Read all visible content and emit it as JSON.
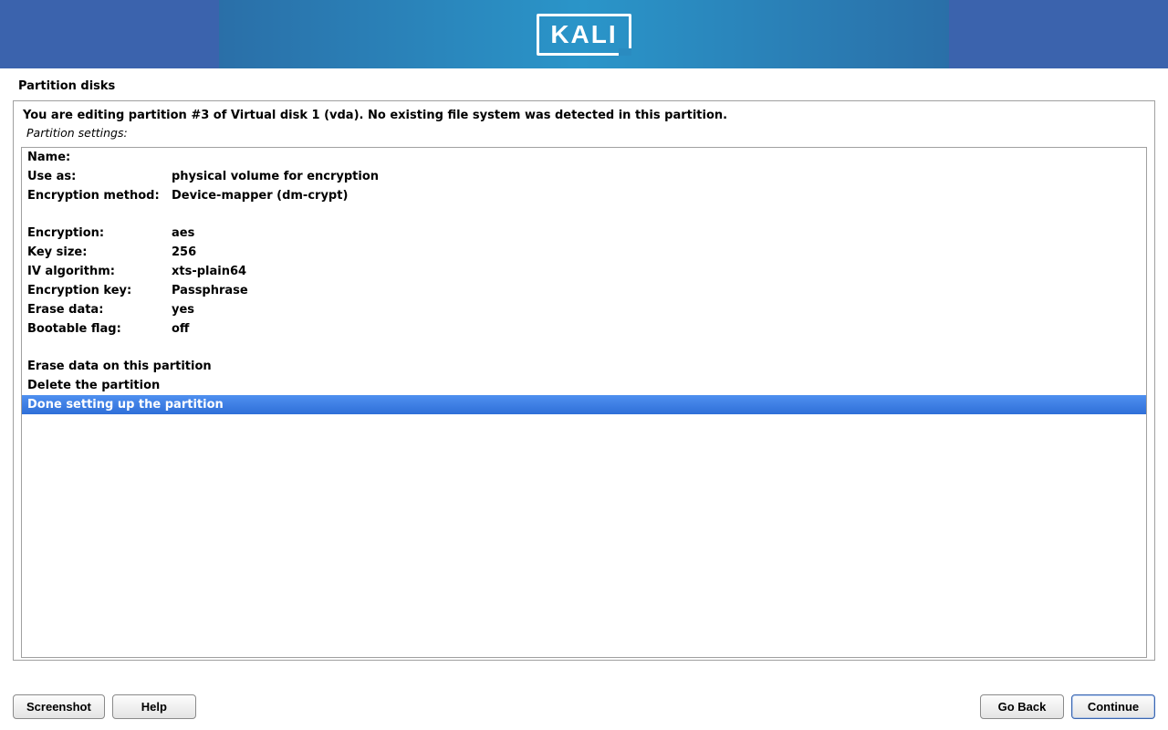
{
  "header": {
    "brand": "KALI"
  },
  "page_title": "Partition disks",
  "description": "You are editing partition #3 of Virtual disk 1 (vda). No existing file system was detected in this partition.",
  "sub_description": "Partition settings:",
  "settings_group1": [
    {
      "key": "Name:",
      "value": ""
    },
    {
      "key": "Use as:",
      "value": "physical volume for encryption"
    },
    {
      "key": "Encryption method:",
      "value": "Device-mapper (dm-crypt)"
    }
  ],
  "settings_group2": [
    {
      "key": "Encryption:",
      "value": "aes"
    },
    {
      "key": "Key size:",
      "value": "256"
    },
    {
      "key": "IV algorithm:",
      "value": "xts-plain64"
    },
    {
      "key": "Encryption key:",
      "value": "Passphrase"
    },
    {
      "key": "Erase data:",
      "value": "yes"
    },
    {
      "key": "Bootable flag:",
      "value": "off"
    }
  ],
  "actions": [
    {
      "label": "Erase data on this partition",
      "selected": false
    },
    {
      "label": "Delete the partition",
      "selected": false
    },
    {
      "label": "Done setting up the partition",
      "selected": true
    }
  ],
  "buttons": {
    "screenshot": "Screenshot",
    "help": "Help",
    "go_back": "Go Back",
    "continue": "Continue"
  }
}
